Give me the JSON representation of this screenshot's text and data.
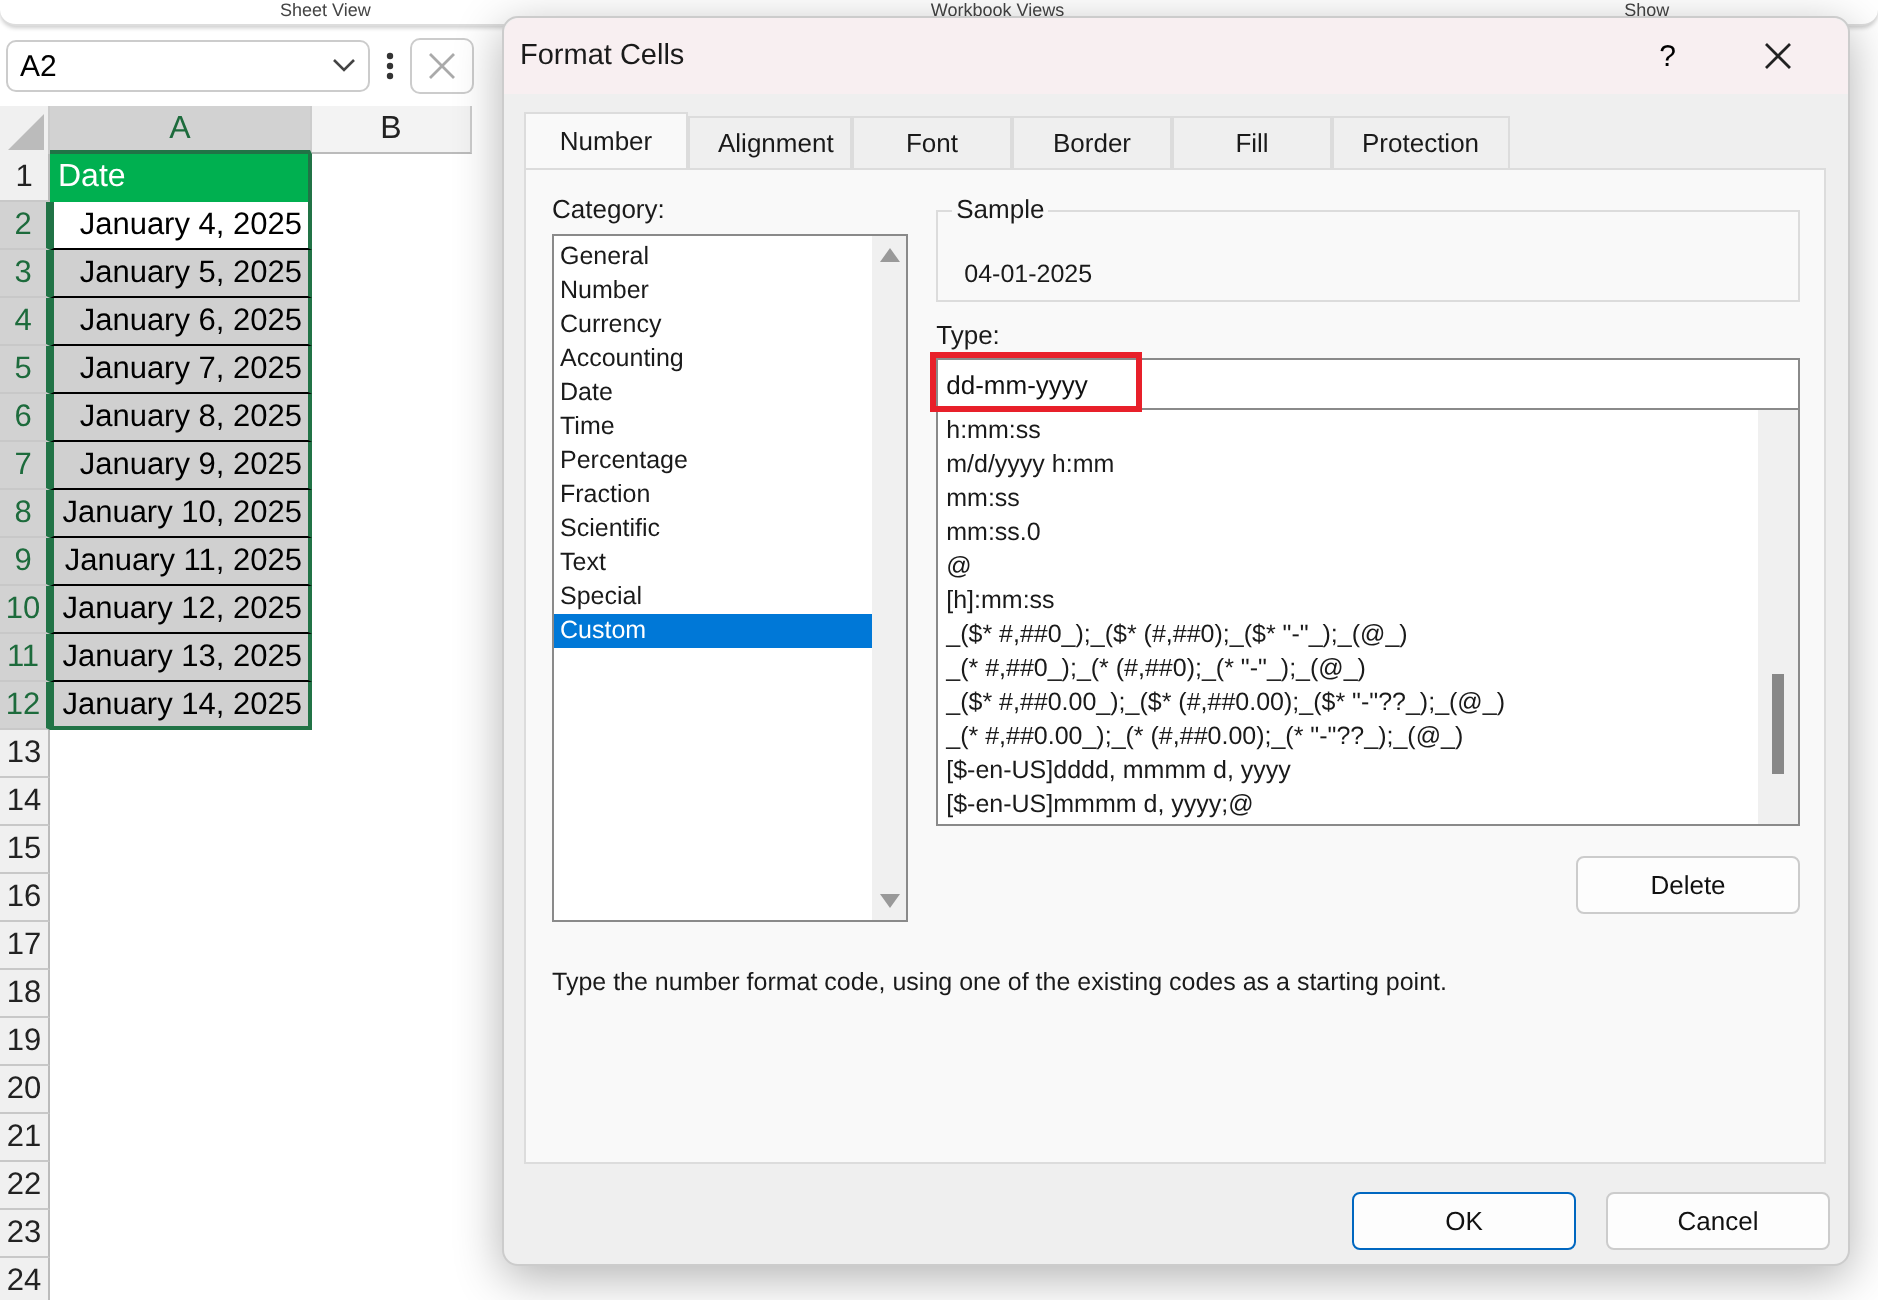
{
  "ribbon_groups": [
    "Sheet View",
    "Workbook Views",
    "Show"
  ],
  "name_box": {
    "value": "A2"
  },
  "columns": [
    {
      "label": "A",
      "selected": true
    },
    {
      "label": "B",
      "selected": false
    }
  ],
  "rows": [
    {
      "number": "1",
      "cell": "Date",
      "kind": "header",
      "selected": false
    },
    {
      "number": "2",
      "cell": "January 4, 2025",
      "kind": "data",
      "selected": true,
      "active": true
    },
    {
      "number": "3",
      "cell": "January 5, 2025",
      "kind": "data",
      "selected": true,
      "active": false
    },
    {
      "number": "4",
      "cell": "January 6, 2025",
      "kind": "data",
      "selected": true,
      "active": false
    },
    {
      "number": "5",
      "cell": "January 7, 2025",
      "kind": "data",
      "selected": true,
      "active": false
    },
    {
      "number": "6",
      "cell": "January 8, 2025",
      "kind": "data",
      "selected": true,
      "active": false
    },
    {
      "number": "7",
      "cell": "January 9, 2025",
      "kind": "data",
      "selected": true,
      "active": false
    },
    {
      "number": "8",
      "cell": "January 10, 2025",
      "kind": "data",
      "selected": true,
      "active": false
    },
    {
      "number": "9",
      "cell": "January 11, 2025",
      "kind": "data",
      "selected": true,
      "active": false
    },
    {
      "number": "10",
      "cell": "January 12, 2025",
      "kind": "data",
      "selected": true,
      "active": false
    },
    {
      "number": "11",
      "cell": "January 13, 2025",
      "kind": "data",
      "selected": true,
      "active": false
    },
    {
      "number": "12",
      "cell": "January 14, 2025",
      "kind": "data",
      "selected": true,
      "active": false
    },
    {
      "number": "13",
      "kind": "empty",
      "selected": false
    },
    {
      "number": "14",
      "kind": "empty",
      "selected": false
    },
    {
      "number": "15",
      "kind": "empty",
      "selected": false
    },
    {
      "number": "16",
      "kind": "empty",
      "selected": false
    },
    {
      "number": "17",
      "kind": "empty",
      "selected": false
    },
    {
      "number": "18",
      "kind": "empty",
      "selected": false
    },
    {
      "number": "19",
      "kind": "empty",
      "selected": false
    },
    {
      "number": "20",
      "kind": "empty",
      "selected": false
    },
    {
      "number": "21",
      "kind": "empty",
      "selected": false
    },
    {
      "number": "22",
      "kind": "empty",
      "selected": false
    },
    {
      "number": "23",
      "kind": "empty",
      "selected": false
    },
    {
      "number": "24",
      "kind": "empty",
      "selected": false
    }
  ],
  "dialog": {
    "title": "Format Cells",
    "help": "?",
    "tabs": [
      {
        "label": "Number",
        "selected": true
      },
      {
        "label": "Alignment",
        "selected": false
      },
      {
        "label": "Font",
        "selected": false
      },
      {
        "label": "Border",
        "selected": false
      },
      {
        "label": "Fill",
        "selected": false
      },
      {
        "label": "Protection",
        "selected": false
      }
    ],
    "category_label": "Category:",
    "categories": [
      {
        "label": "General",
        "selected": false
      },
      {
        "label": "Number",
        "selected": false
      },
      {
        "label": "Currency",
        "selected": false
      },
      {
        "label": "Accounting",
        "selected": false
      },
      {
        "label": "Date",
        "selected": false
      },
      {
        "label": "Time",
        "selected": false
      },
      {
        "label": "Percentage",
        "selected": false
      },
      {
        "label": "Fraction",
        "selected": false
      },
      {
        "label": "Scientific",
        "selected": false
      },
      {
        "label": "Text",
        "selected": false
      },
      {
        "label": "Special",
        "selected": false
      },
      {
        "label": "Custom",
        "selected": true
      }
    ],
    "sample_label": "Sample",
    "sample_value": "04-01-2025",
    "type_label": "Type:",
    "type_value": "dd-mm-yyyy",
    "type_highlighted": true,
    "formats": [
      "h:mm:ss",
      "m/d/yyyy h:mm",
      "mm:ss",
      "mm:ss.0",
      "@",
      "[h]:mm:ss",
      "_($* #,##0_);_($* (#,##0);_($* \"-\"_);_(@_)",
      "_(* #,##0_);_(* (#,##0);_(* \"-\"_);_(@_)",
      "_($* #,##0.00_);_($* (#,##0.00);_($* \"-\"??_);_(@_)",
      "_(* #,##0.00_);_(* (#,##0.00);_(* \"-\"??_);_(@_)",
      "[$-en-US]dddd, mmmm d, yyyy",
      "[$-en-US]mmmm d, yyyy;@"
    ],
    "delete_button": "Delete",
    "description": "Type the number format code, using one of the existing codes as a starting point.",
    "buttons": [
      {
        "label": "OK",
        "default": true
      },
      {
        "label": "Cancel",
        "default": false
      }
    ]
  }
}
